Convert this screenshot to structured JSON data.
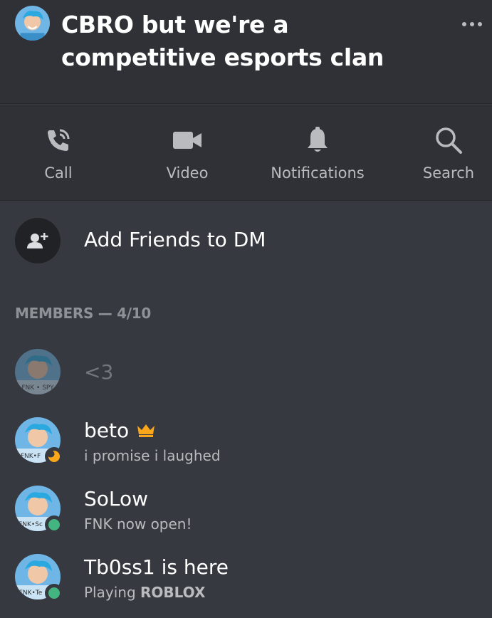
{
  "header": {
    "title": "CBRO but we're a competitive esports clan",
    "more_icon": "more-horizontal-icon"
  },
  "actions": [
    {
      "label": "Call",
      "icon": "phone-call-icon"
    },
    {
      "label": "Video",
      "icon": "video-camera-icon"
    },
    {
      "label": "Notifications",
      "icon": "bell-icon"
    },
    {
      "label": "Search",
      "icon": "search-icon"
    }
  ],
  "add_friends": {
    "label": "Add Friends to DM",
    "icon": "add-user-icon"
  },
  "members": {
    "header": "MEMBERS — 4/10",
    "list": [
      {
        "name": "<3",
        "status": "",
        "activity": "",
        "avatar_text": "FNK • SPY"
      },
      {
        "name": "beto",
        "status": "idle",
        "activity": "i promise i laughed",
        "badge": "crown-icon",
        "avatar_text": "FNK•F"
      },
      {
        "name": "SoLow",
        "status": "online",
        "activity": "FNK now open!",
        "avatar_text": "FNK•Sc"
      },
      {
        "name": "Tb0ss1 is here",
        "status": "online",
        "activity_prefix": "Playing",
        "activity_game": "ROBLOX",
        "avatar_text": "FNK•Te"
      }
    ]
  },
  "colors": {
    "background": "#36393f",
    "header_bg": "#2f3136",
    "online": "#43b581",
    "idle": "#faa61a",
    "crown": "#faa61a"
  }
}
